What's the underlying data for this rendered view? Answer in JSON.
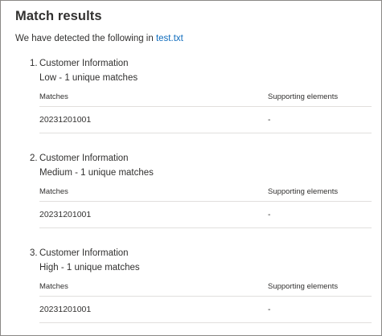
{
  "panel": {
    "title": "Match results",
    "intro_text": "We have detected the following in ",
    "file_link": "test.txt"
  },
  "results": [
    {
      "number": "1.",
      "title": "Customer Information",
      "subtitle": "Low - 1 unique matches",
      "columns": [
        "Matches",
        "Supporting elements"
      ],
      "rows": [
        [
          "20231201001",
          "-"
        ]
      ]
    },
    {
      "number": "2.",
      "title": "Customer Information",
      "subtitle": "Medium - 1 unique matches",
      "columns": [
        "Matches",
        "Supporting elements"
      ],
      "rows": [
        [
          "20231201001",
          "-"
        ]
      ]
    },
    {
      "number": "3.",
      "title": "Customer Information",
      "subtitle": "High - 1 unique matches",
      "columns": [
        "Matches",
        "Supporting elements"
      ],
      "rows": [
        [
          "20231201001",
          "-"
        ]
      ]
    }
  ]
}
